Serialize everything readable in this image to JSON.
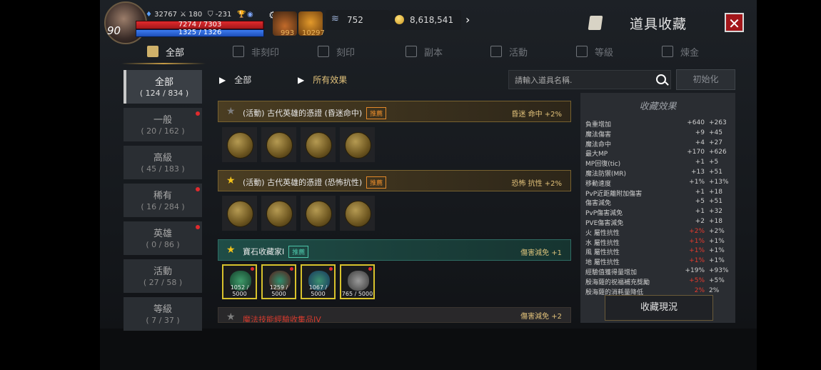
{
  "player": {
    "level": "90",
    "power": "32767",
    "stat_2": "180",
    "stat_3": "-231",
    "hp_text": "7274 / 7303",
    "hp_ratio": 0.996,
    "mp_text": "1325 / 1326",
    "mp_ratio": 0.999
  },
  "hud": {
    "item1_count": "993",
    "item2_count": "10297",
    "currency1": "752",
    "currency2": "8,618,541"
  },
  "window": {
    "title": "道具收藏",
    "close_label": "✕"
  },
  "tabs": [
    {
      "label": "全部",
      "active": true
    },
    {
      "label": "非刻印"
    },
    {
      "label": "刻印"
    },
    {
      "label": "副本"
    },
    {
      "label": "活動"
    },
    {
      "label": "等級"
    },
    {
      "label": "煉金"
    }
  ],
  "categories": [
    {
      "name": "全部",
      "count": "( 124 / 834 )",
      "active": true
    },
    {
      "name": "一般",
      "count": "( 20 / 162 )",
      "dot": true
    },
    {
      "name": "高級",
      "count": "( 45 / 183 )"
    },
    {
      "name": "稀有",
      "count": "( 16 / 284 )",
      "dot": true
    },
    {
      "name": "英雄",
      "count": "( 0 / 86 )",
      "dot": true
    },
    {
      "name": "活動",
      "count": "( 27 / 58 )"
    },
    {
      "name": "等級",
      "count": "( 7 / 37 )"
    }
  ],
  "filters": {
    "filter1": "全部",
    "filter2": "所有效果"
  },
  "search": {
    "placeholder": "請輸入道具名稱."
  },
  "reset_label": "初始化",
  "collections": [
    {
      "name": "(活動) 古代英雄的憑證 (昏迷命中)",
      "badge": "推薦",
      "effect": "昏迷 命中 +2%",
      "starred": false
    },
    {
      "name": "(活動) 古代英雄的憑證 (恐怖抗性)",
      "badge": "推薦",
      "effect": "恐怖 抗性 +2%",
      "starred": true
    },
    {
      "name": "寶石收藏家I",
      "badge": "推薦",
      "effect": "傷害減免 +1",
      "starred": true,
      "slots": [
        "1052 / 5000",
        "1259 / 5000",
        "1067 / 5000",
        "765 / 5000"
      ]
    },
    {
      "name": "魔法技能經驗收集品IV",
      "effect": "傷害減免 +2",
      "starred": false
    }
  ],
  "effects_panel": {
    "title": "收藏效果",
    "rows": [
      {
        "name": "負重增加",
        "a": "+640",
        "b": "+263"
      },
      {
        "name": "魔法傷害",
        "a": "+9",
        "b": "+45"
      },
      {
        "name": "魔法命中",
        "a": "+4",
        "b": "+27"
      },
      {
        "name": "最大MP",
        "a": "+170",
        "b": "+626"
      },
      {
        "name": "MP回復(tic)",
        "a": "+1",
        "b": "+5"
      },
      {
        "name": "魔法防禦(MR)",
        "a": "+13",
        "b": "+51"
      },
      {
        "name": "移動速度",
        "a": "+1%",
        "b": "+13%"
      },
      {
        "name": "PvP近距離附加傷害",
        "a": "+1",
        "b": "+18"
      },
      {
        "name": "傷害減免",
        "a": "+5",
        "b": "+51"
      },
      {
        "name": "PvP傷害減免",
        "a": "+1",
        "b": "+32"
      },
      {
        "name": "PVE傷害減免",
        "a": "+2",
        "b": "+18"
      },
      {
        "name": "火 屬性抗性",
        "a": "+2%",
        "b": "+2%",
        "red": true
      },
      {
        "name": "水 屬性抗性",
        "a": "+1%",
        "b": "+1%",
        "red": true
      },
      {
        "name": "風 屬性抗性",
        "a": "+1%",
        "b": "+1%",
        "red": true
      },
      {
        "name": "地 屬性抗性",
        "a": "+1%",
        "b": "+1%",
        "red": true
      },
      {
        "name": "經驗值獲得量增加",
        "a": "+19%",
        "b": "+93%"
      },
      {
        "name": "殷海薩的祝福補充獎勵",
        "a": "+5%",
        "b": "+5%",
        "red": true
      },
      {
        "name": "殷海薩的消耗量降低",
        "a": "2%",
        "b": "2%",
        "red": true
      }
    ],
    "status_button": "收藏現況"
  }
}
